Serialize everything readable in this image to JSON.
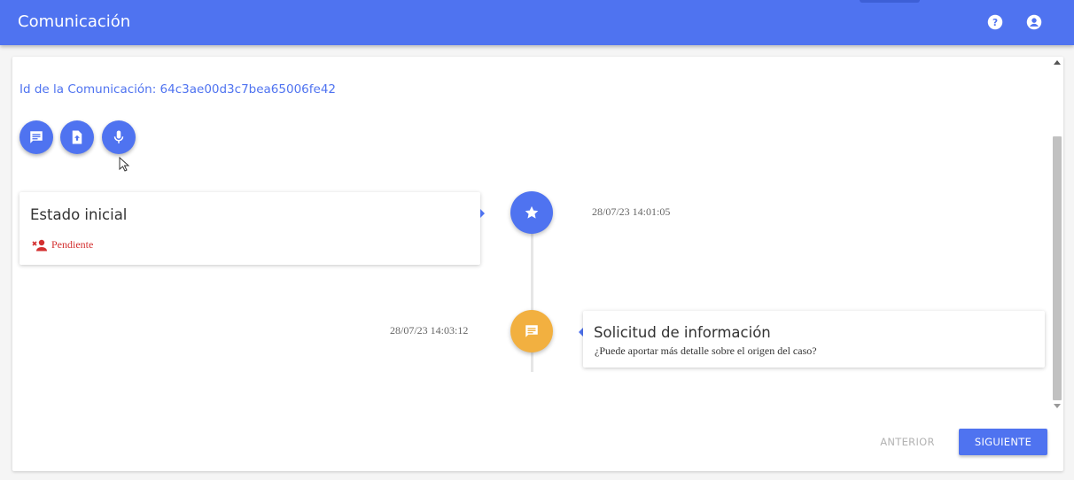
{
  "app": {
    "title": "Comunicación"
  },
  "header": {
    "help_icon": "help-circle-icon",
    "account_icon": "account-circle-icon"
  },
  "communication": {
    "id_label": "Id de la Comunicación: 64c3ae00d3c7bea65006fe42"
  },
  "actions": [
    {
      "name": "message-icon"
    },
    {
      "name": "upload-file-icon"
    },
    {
      "name": "microphone-icon"
    }
  ],
  "timeline": [
    {
      "title": "Estado inicial",
      "status": "Pendiente",
      "timestamp": "28/07/23 14:01:05",
      "icon": "star-icon"
    },
    {
      "title": "Solicitud de información",
      "body": "¿Puede aportar más detalle sobre el origen del caso?",
      "timestamp": "28/07/23 14:03:12",
      "icon": "message-icon"
    }
  ],
  "nav": {
    "prev_label": "ANTERIOR",
    "next_label": "SIGUIENTE"
  },
  "colors": {
    "primary": "#4f73f0",
    "accent": "#f2b040",
    "status_red": "#d32f2f"
  }
}
